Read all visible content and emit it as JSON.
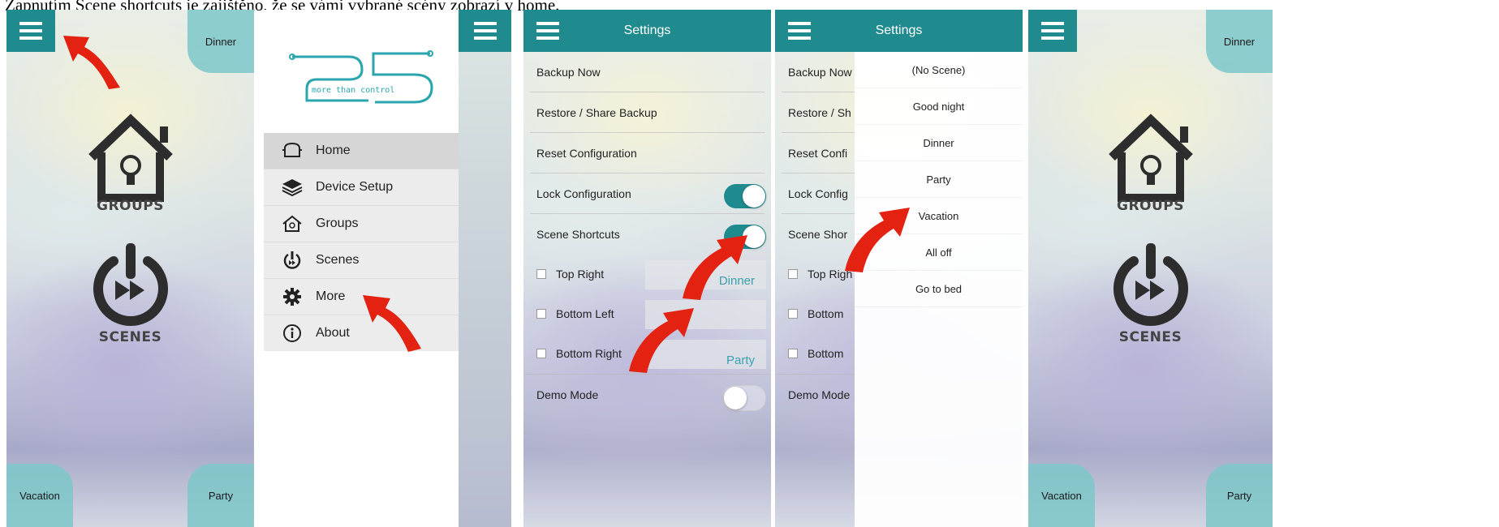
{
  "caption": "Zapnutím Scene shortcuts je zajištěno, že se vámi vybrané scény zobrazí v home.",
  "colors": {
    "accent": "#1f8b8f",
    "corner": "#7cc7c9",
    "value_text": "#3a9fb0",
    "arrow": "#e32212"
  },
  "home": {
    "groups_label": "GROUPS",
    "scenes_label": "SCENES",
    "top_right": "Dinner",
    "bottom_left": "Vacation",
    "bottom_right": "Party"
  },
  "drawer": {
    "logo_text": "more than control",
    "items": [
      {
        "label": "Home",
        "icon": "sofa-icon"
      },
      {
        "label": "Device Setup",
        "icon": "layers-icon"
      },
      {
        "label": "Groups",
        "icon": "house-icon"
      },
      {
        "label": "Scenes",
        "icon": "power-icon"
      },
      {
        "label": "More",
        "icon": "gear-icon"
      },
      {
        "label": "About",
        "icon": "info-icon"
      }
    ]
  },
  "settings": {
    "title": "Settings",
    "rows": {
      "backup": "Backup Now",
      "restore": "Restore / Share Backup",
      "reset": "Reset Configuration",
      "lock": "Lock Configuration",
      "shortcuts": "Scene Shortcuts",
      "top_right": "Top Right",
      "bottom_left": "Bottom Left",
      "bottom_right": "Bottom Right",
      "demo": "Demo Mode"
    },
    "values": {
      "top_right": "Dinner",
      "bottom_left": "",
      "bottom_right": "Party"
    },
    "toggles": {
      "lock": true,
      "shortcuts": true,
      "demo": false
    }
  },
  "settings_cut": {
    "backup": "Backup Now",
    "restore": "Restore / Sh",
    "reset": "Reset Confi",
    "lock": "Lock Config",
    "shortcuts": "Scene Shor",
    "top_right": "Top Righ",
    "bottom_left": "Bottom",
    "bottom_right": "Bottom",
    "demo": "Demo Mode"
  },
  "scene_picker": {
    "options": [
      "(No Scene)",
      "Good night",
      "Dinner",
      "Party",
      "Vacation",
      "All off",
      "Go to bed"
    ]
  }
}
